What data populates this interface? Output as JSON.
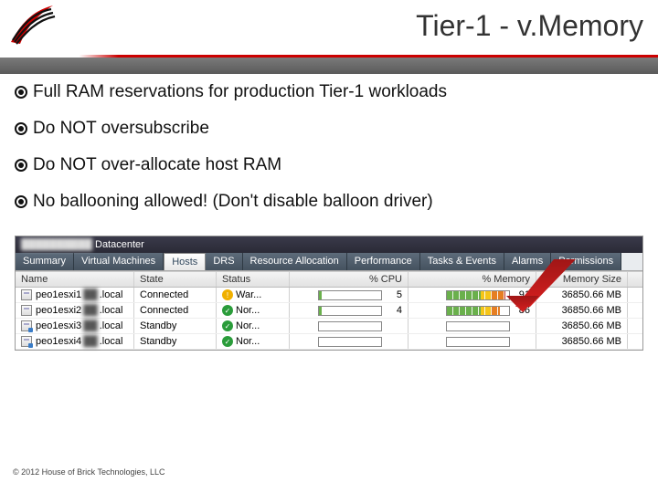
{
  "header": {
    "title": "Tier-1 - v.Memory"
  },
  "bullets": [
    "Full RAM reservations for production Tier-1 workloads",
    "Do NOT oversubscribe",
    "Do NOT over-allocate host RAM",
    "No ballooning allowed! (Don't disable balloon driver)"
  ],
  "panel": {
    "title_blur": "██████████",
    "title_suffix": "Datacenter",
    "tabs": [
      "Summary",
      "Virtual Machines",
      "Hosts",
      "DRS",
      "Resource Allocation",
      "Performance",
      "Tasks & Events",
      "Alarms",
      "Permissions"
    ],
    "active_tab": 2,
    "columns": [
      "Name",
      "State",
      "Status",
      "% CPU",
      "% Memory",
      "Memory Size"
    ],
    "rows": [
      {
        "name_pre": "peo1esxi1",
        "name_blur": "██",
        "name_suf": ".local",
        "state": "Connected",
        "status": "War...",
        "status_kind": "warn",
        "cpu": 5,
        "mem": 91,
        "msize": "36850.66 MB",
        "standby": false,
        "mem_high": true
      },
      {
        "name_pre": "peo1esxi2",
        "name_blur": "██",
        "name_suf": ".local",
        "state": "Connected",
        "status": "Nor...",
        "status_kind": "ok",
        "cpu": 4,
        "mem": 86,
        "msize": "36850.66 MB",
        "standby": false,
        "mem_high": true
      },
      {
        "name_pre": "peo1esxi3",
        "name_blur": "██",
        "name_suf": ".local",
        "state": "Standby",
        "status": "Nor...",
        "status_kind": "ok",
        "cpu": null,
        "mem": null,
        "msize": "36850.66 MB",
        "standby": true,
        "mem_high": false
      },
      {
        "name_pre": "peo1esxi4",
        "name_blur": "██",
        "name_suf": ".local",
        "state": "Standby",
        "status": "Nor...",
        "status_kind": "ok",
        "cpu": null,
        "mem": null,
        "msize": "36850.66 MB",
        "standby": true,
        "mem_high": false
      }
    ]
  },
  "footer": "© 2012 House of Brick Technologies, LLC"
}
